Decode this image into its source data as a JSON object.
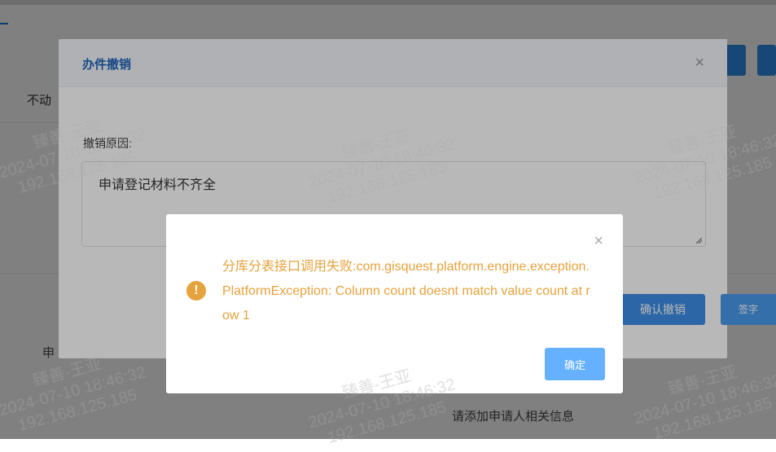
{
  "background": {
    "left_label_top": "不动",
    "left_label_bottom": "申",
    "bottom_info": "请添加申请人相关信息",
    "sign_button": "签字"
  },
  "revoke_dialog": {
    "title": "办件撤销",
    "close_glyph": "×",
    "reason_label": "撤销原因:",
    "reason_value": "申请登记材料不齐全",
    "confirm_label": "确认撤销"
  },
  "error_dialog": {
    "close_glyph": "×",
    "icon_glyph": "!",
    "message": "分库分表接口调用失败:com.gisquest.platform.engine.exception.PlatformException: Column count doesnt match value count at row 1",
    "ok_label": "确定"
  },
  "watermark": {
    "name": "臻善-王亚",
    "time": "2024-07-10 18:46:32",
    "ip": "192.168.125.185"
  },
  "colors": {
    "accent": "#2f8ee8",
    "warning": "#e6a23c",
    "title": "#1f65b8"
  }
}
